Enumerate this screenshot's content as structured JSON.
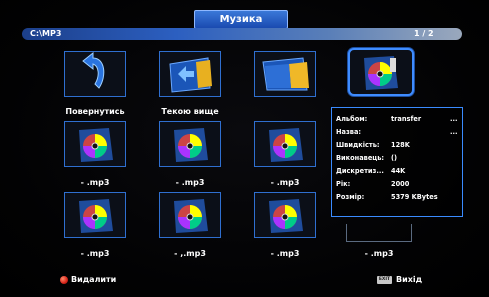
{
  "header": {
    "title": "Музика"
  },
  "pathbar": {
    "path": "C:\\MP3",
    "page": "1 / 2"
  },
  "grid": {
    "items": [
      {
        "label": "Повернутись",
        "icon": "back-arrow-icon"
      },
      {
        "label": "Текою вище",
        "icon": "folder-up-icon"
      },
      {
        "label": "",
        "icon": "folder-icon"
      },
      {
        "label": "",
        "icon": "music-disc-icon",
        "selected": true
      },
      {
        "label": "- .mp3",
        "icon": "music-disc-icon"
      },
      {
        "label": "- .mp3",
        "icon": "music-disc-icon"
      },
      {
        "label": "- .mp3",
        "icon": "music-disc-icon"
      },
      {
        "label": "- .mp3",
        "icon": "music-disc-icon"
      },
      {
        "label": "- ,.mp3",
        "icon": "music-disc-icon"
      },
      {
        "label": "- .mp3",
        "icon": "music-disc-icon"
      },
      {
        "label": "- .mp3",
        "icon": "music-disc-icon"
      }
    ]
  },
  "info": {
    "rows": [
      {
        "key": "Альбом:",
        "value": "transfer",
        "more": "..."
      },
      {
        "key": "Назва:",
        "value": "",
        "more": "..."
      },
      {
        "key": "Швидкість:",
        "value": "128K",
        "more": ""
      },
      {
        "key": "Виконавець:",
        "value": "()",
        "more": ""
      },
      {
        "key": "Дискретиз...",
        "value": "44K",
        "more": ""
      },
      {
        "key": "Рік:",
        "value": "2000",
        "more": ""
      },
      {
        "key": "Розмір:",
        "value": "5379 KBytes",
        "more": ""
      }
    ]
  },
  "footer": {
    "delete_label": "Видалити",
    "exit_key": "EXIT",
    "exit_label": "Вихід"
  },
  "colors": {
    "accent": "#2f6fd0",
    "highlight": "#3f8cff",
    "delete": "#d8241a"
  }
}
